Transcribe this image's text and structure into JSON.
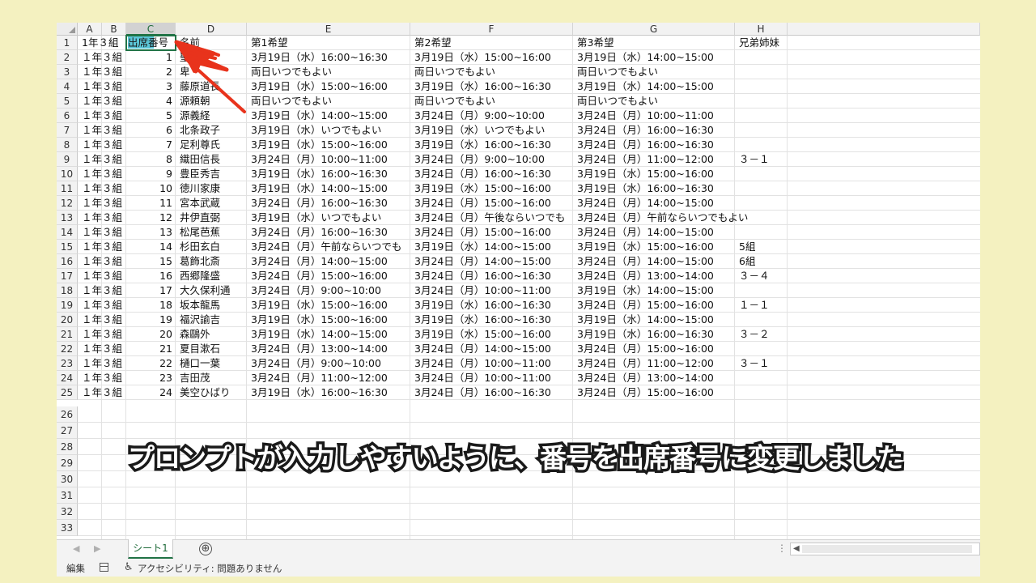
{
  "columns": [
    "A",
    "B",
    "C",
    "D",
    "E",
    "F",
    "G",
    "H"
  ],
  "selected_column": "C",
  "rows": [
    [
      "1年３組",
      "",
      "",
      "名前",
      "第1希望",
      "第2希望",
      "第3希望",
      "兄弟姉妹"
    ],
    [
      "１年３組",
      "",
      "1",
      "聖",
      "3月19日（水）16:00~16:30",
      "3月19日（水）15:00~16:00",
      "3月19日（水）14:00~15:00",
      ""
    ],
    [
      "１年３組",
      "",
      "2",
      "卑",
      "両日いつでもよい",
      "両日いつでもよい",
      "両日いつでもよい",
      ""
    ],
    [
      "１年３組",
      "",
      "3",
      "藤原道長",
      "3月19日（水）15:00~16:00",
      "3月19日（水）16:00~16:30",
      "3月19日（水）14:00~15:00",
      ""
    ],
    [
      "１年３組",
      "",
      "4",
      "源頼朝",
      "両日いつでもよい",
      "両日いつでもよい",
      "両日いつでもよい",
      ""
    ],
    [
      "１年３組",
      "",
      "5",
      "源義経",
      "3月19日（水）14:00~15:00",
      "3月24日（月）9:00~10:00",
      "3月24日（月）10:00~11:00",
      ""
    ],
    [
      "１年３組",
      "",
      "6",
      "北条政子",
      "3月19日（水）いつでもよい",
      "3月19日（水）いつでもよい",
      "3月24日（月）16:00~16:30",
      ""
    ],
    [
      "１年３組",
      "",
      "7",
      "足利尊氏",
      "3月19日（水）15:00~16:00",
      "3月19日（水）16:00~16:30",
      "3月24日（月）16:00~16:30",
      ""
    ],
    [
      "１年３組",
      "",
      "8",
      "織田信長",
      "3月24日（月）10:00~11:00",
      "3月24日（月）9:00~10:00",
      "3月24日（月）11:00~12:00",
      "３－１"
    ],
    [
      "１年３組",
      "",
      "9",
      "豊臣秀吉",
      "3月19日（水）16:00~16:30",
      "3月24日（月）16:00~16:30",
      "3月19日（水）15:00~16:00",
      ""
    ],
    [
      "１年３組",
      "",
      "10",
      "徳川家康",
      "3月19日（水）14:00~15:00",
      "3月19日（水）15:00~16:00",
      "3月19日（水）16:00~16:30",
      ""
    ],
    [
      "１年３組",
      "",
      "11",
      "宮本武蔵",
      "3月24日（月）16:00~16:30",
      "3月24日（月）15:00~16:00",
      "3月24日（月）14:00~15:00",
      ""
    ],
    [
      "１年３組",
      "",
      "12",
      "井伊直弼",
      "3月19日（水）いつでもよい",
      "3月24日（月）午後ならいつでも",
      "3月24日（月）午前ならいつでもよい",
      ""
    ],
    [
      "１年３組",
      "",
      "13",
      "松尾芭蕉",
      "3月24日（月）16:00~16:30",
      "3月24日（月）15:00~16:00",
      "3月24日（月）14:00~15:00",
      ""
    ],
    [
      "１年３組",
      "",
      "14",
      "杉田玄白",
      "3月24日（月）午前ならいつでも",
      "3月19日（水）14:00~15:00",
      "3月19日（水）15:00~16:00",
      "5組"
    ],
    [
      "１年３組",
      "",
      "15",
      "葛飾北斎",
      "3月24日（月）14:00~15:00",
      "3月24日（月）14:00~15:00",
      "3月24日（月）14:00~15:00",
      "6組"
    ],
    [
      "１年３組",
      "",
      "16",
      "西郷隆盛",
      "3月24日（月）15:00~16:00",
      "3月24日（月）16:00~16:30",
      "3月24日（月）13:00~14:00",
      "３－４"
    ],
    [
      "１年３組",
      "",
      "17",
      "大久保利通",
      "3月24日（月）9:00~10:00",
      "3月24日（月）10:00~11:00",
      "3月19日（水）14:00~15:00",
      ""
    ],
    [
      "１年３組",
      "",
      "18",
      "坂本龍馬",
      "3月19日（水）15:00~16:00",
      "3月19日（水）16:00~16:30",
      "3月24日（月）15:00~16:00",
      "１－１"
    ],
    [
      "１年３組",
      "",
      "19",
      "福沢諭吉",
      "3月19日（水）15:00~16:00",
      "3月19日（水）16:00~16:30",
      "3月19日（水）14:00~15:00",
      ""
    ],
    [
      "１年３組",
      "",
      "20",
      "森鷗外",
      "3月19日（水）14:00~15:00",
      "3月19日（水）15:00~16:00",
      "3月19日（水）16:00~16:30",
      "３－２"
    ],
    [
      "１年３組",
      "",
      "21",
      "夏目漱石",
      "3月24日（月）13:00~14:00",
      "3月24日（月）14:00~15:00",
      "3月24日（月）15:00~16:00",
      ""
    ],
    [
      "１年３組",
      "",
      "22",
      "樋口一葉",
      "3月24日（月）9:00~10:00",
      "3月24日（月）10:00~11:00",
      "3月24日（月）11:00~12:00",
      "３－１"
    ],
    [
      "１年３組",
      "",
      "23",
      "吉田茂",
      "3月24日（月）11:00~12:00",
      "3月24日（月）10:00~11:00",
      "3月24日（月）13:00~14:00",
      ""
    ],
    [
      "１年３組",
      "",
      "24",
      "美空ひばり",
      "3月19日（水）16:00~16:30",
      "3月24日（月）16:00~16:30",
      "3月24日（月）15:00~16:00",
      ""
    ]
  ],
  "row_numbers": [
    "1",
    "2",
    "3",
    "4",
    "5",
    "6",
    "7",
    "8",
    "9",
    "10",
    "11",
    "12",
    "13",
    "14",
    "15",
    "16",
    "17",
    "18",
    "19",
    "20",
    "21",
    "22",
    "23",
    "24",
    "25",
    "26",
    "27",
    "28",
    "29",
    "30",
    "31",
    "32",
    "33"
  ],
  "active_cell": {
    "text": "出席番号",
    "highlight": "出席",
    "rest": "番号"
  },
  "caption": "プロンプトが入力しやすいように、番号を出席番号に変更しました",
  "tabs": {
    "sheet": "シート1",
    "add": "⊕"
  },
  "status": {
    "mode": "編集",
    "accessibility": "アクセシビリティ: 問題ありません"
  },
  "colors": {
    "accent": "#217346",
    "highlight": "#5bc7d8",
    "arrow": "#e8331c",
    "background": "#f4f1c0"
  }
}
